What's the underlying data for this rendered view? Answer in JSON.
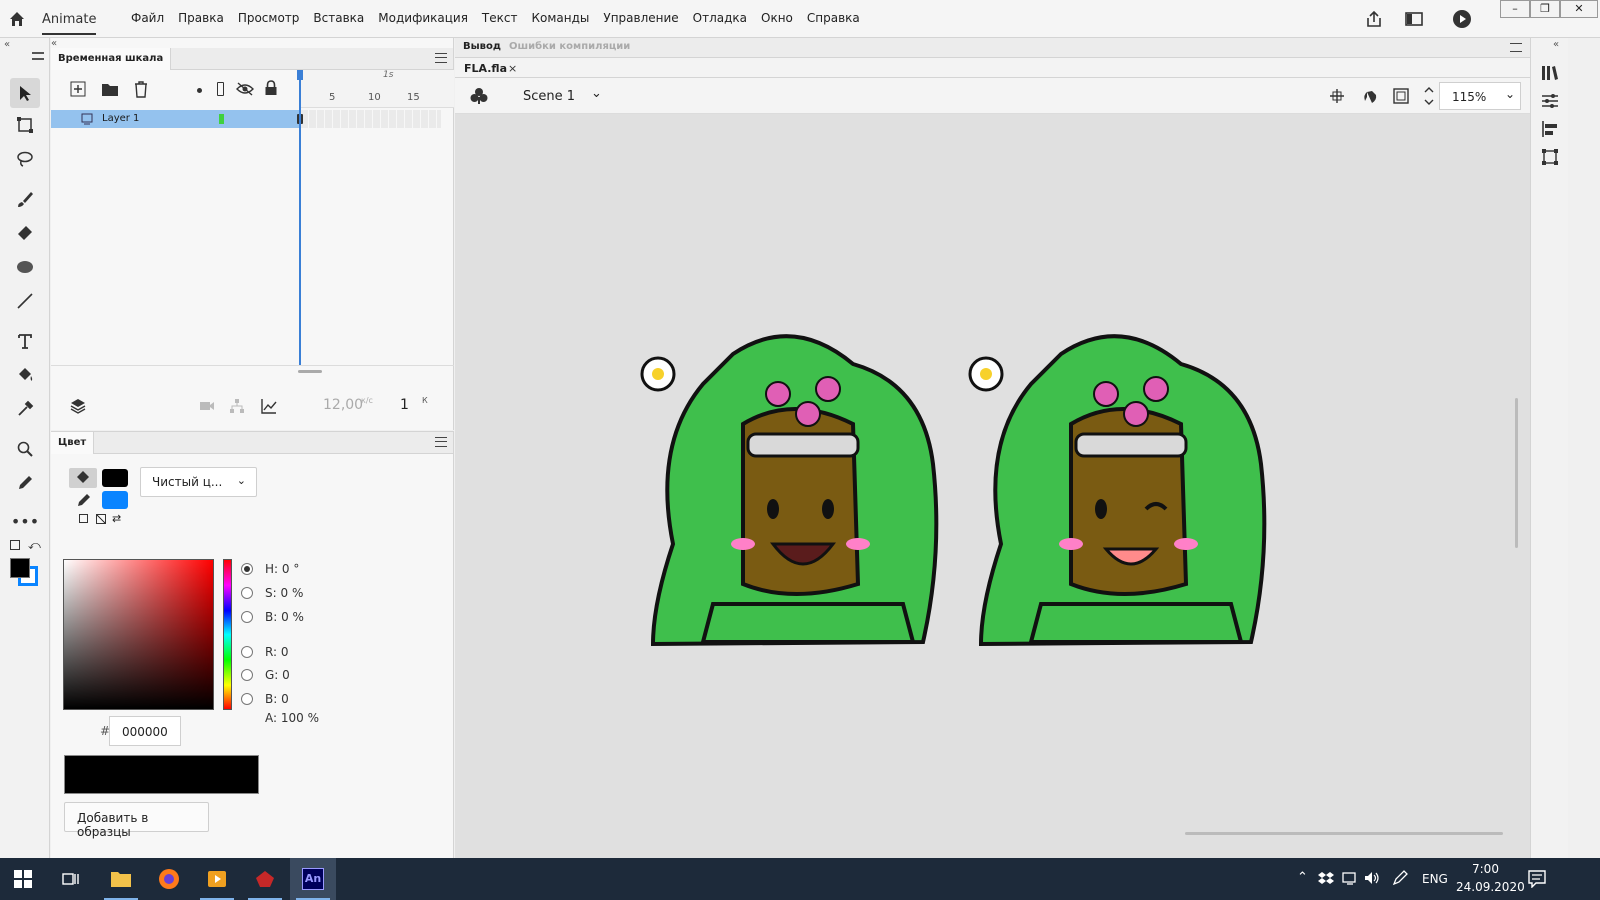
{
  "menubar": {
    "app_name": "Animate",
    "menu_items": [
      "Файл",
      "Правка",
      "Просмотр",
      "Вставка",
      "Модификация",
      "Текст",
      "Команды",
      "Управление",
      "Отладка",
      "Окно",
      "Справка"
    ]
  },
  "timeline": {
    "tab_label": "Временная шкала",
    "frame_marks": [
      "1s",
      "5",
      "10",
      "15"
    ],
    "layer_name": "Layer 1",
    "fps_value": "12,00",
    "fps_unit": "к/с",
    "current_frame": "1",
    "frame_unit": "К"
  },
  "color_panel": {
    "tab_label": "Цвет",
    "fill_type": "Чистый ц...",
    "fill_color": "#000000",
    "stroke_color": "#0a84ff",
    "fields": [
      {
        "label": "H:",
        "value": "0 °"
      },
      {
        "label": "S:",
        "value": "0 %"
      },
      {
        "label": "B:",
        "value": "0 %"
      },
      {
        "label": "R:",
        "value": "0"
      },
      {
        "label": "G:",
        "value": "0"
      },
      {
        "label": "B:",
        "value": "0"
      }
    ],
    "alpha_label": "A:",
    "alpha_value": "100 %",
    "hex_prefix": "#",
    "hex_value": "000000",
    "add_swatch_label": "Добавить в образцы"
  },
  "stage": {
    "output_tab": "Вывод",
    "errors_tab": "Ошибки компиляции",
    "document_tab": "FLA.fla",
    "scene_name": "Scene 1",
    "zoom": "115%",
    "background": "#e0e0e0"
  },
  "taskbar": {
    "language": "ENG",
    "time": "7:00",
    "date": "24.09.2020",
    "active_app_label": "An"
  }
}
